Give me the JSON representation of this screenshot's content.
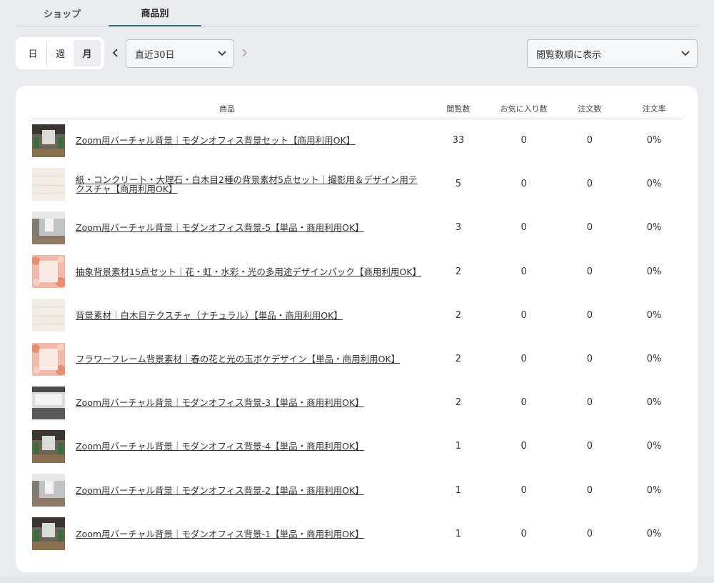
{
  "tabs": [
    {
      "label": "ショップ",
      "active": false
    },
    {
      "label": "商品別",
      "active": true
    }
  ],
  "period": {
    "buttons": [
      "日",
      "週",
      "月"
    ],
    "active": "月"
  },
  "date_range": {
    "selected": "直近30日"
  },
  "sort": {
    "selected": "閲覧数順に表示"
  },
  "table": {
    "headers": [
      "商品",
      "閲覧数",
      "お気に入り数",
      "注文数",
      "注文率"
    ],
    "rows": [
      {
        "name": "Zoom用バーチャル背景｜モダンオフィス背景セット【商用利用OK】",
        "views": "33",
        "favorites": "0",
        "orders": "0",
        "rate": "0%",
        "thumb": "office"
      },
      {
        "name": "紙・コンクリート・大理石・白木目2種の背景素材5点セット｜撮影用＆デザイン用テクスチャ【商用利用OK】",
        "views": "5",
        "favorites": "0",
        "orders": "0",
        "rate": "0%",
        "thumb": "wood"
      },
      {
        "name": "Zoom用バーチャル背景｜モダンオフィス背景-5【単品・商用利用OK】",
        "views": "3",
        "favorites": "0",
        "orders": "0",
        "rate": "0%",
        "thumb": "office2"
      },
      {
        "name": "抽象背景素材15点セット｜花・虹・水彩・光の多用途デザインパック【商用利用OK】",
        "views": "2",
        "favorites": "0",
        "orders": "0",
        "rate": "0%",
        "thumb": "flower"
      },
      {
        "name": "背景素材｜白木目テクスチャ（ナチュラル）【単品・商用利用OK】",
        "views": "2",
        "favorites": "0",
        "orders": "0",
        "rate": "0%",
        "thumb": "wood"
      },
      {
        "name": "フラワーフレーム背景素材｜春の花と光の玉ボケデザイン【単品・商用利用OK】",
        "views": "2",
        "favorites": "0",
        "orders": "0",
        "rate": "0%",
        "thumb": "flower"
      },
      {
        "name": "Zoom用バーチャル背景｜モダンオフィス背景-3【単品・商用利用OK】",
        "views": "2",
        "favorites": "0",
        "orders": "0",
        "rate": "0%",
        "thumb": "office3"
      },
      {
        "name": "Zoom用バーチャル背景｜モダンオフィス背景-4【単品・商用利用OK】",
        "views": "1",
        "favorites": "0",
        "orders": "0",
        "rate": "0%",
        "thumb": "office"
      },
      {
        "name": "Zoom用バーチャル背景｜モダンオフィス背景-2【単品・商用利用OK】",
        "views": "1",
        "favorites": "0",
        "orders": "0",
        "rate": "0%",
        "thumb": "office2"
      },
      {
        "name": "Zoom用バーチャル背景｜モダンオフィス背景-1【単品・商用利用OK】",
        "views": "1",
        "favorites": "0",
        "orders": "0",
        "rate": "0%",
        "thumb": "office"
      }
    ]
  },
  "icons": {
    "prev": "chevron-left-icon",
    "next": "chevron-right-icon",
    "dropdown": "chevron-down-icon"
  },
  "colors": {
    "active_tab_underline": "#2d6c74",
    "background": "#e9ebee"
  }
}
